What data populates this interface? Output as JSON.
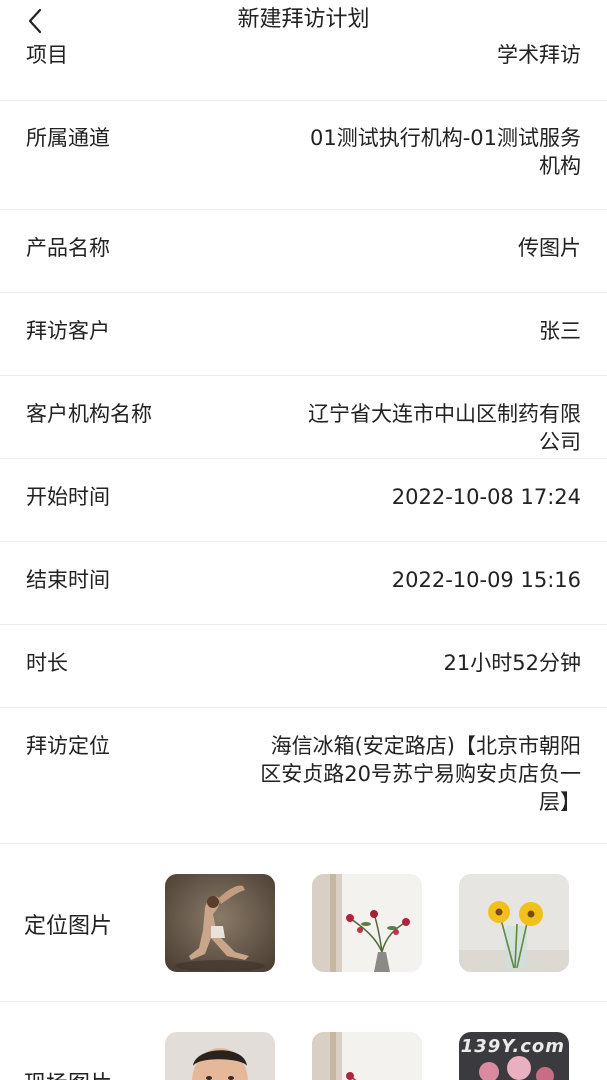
{
  "header": {
    "title": "新建拜访计划",
    "back_icon": "chevron-left-icon"
  },
  "partial_row": {
    "label": "项目",
    "value": "学术拜访"
  },
  "fields": [
    {
      "label": "所属通道",
      "value_lines": [
        "01测试执行机构-01测试服务",
        "机构"
      ]
    },
    {
      "label": "产品名称",
      "value_lines": [
        "传图片"
      ]
    },
    {
      "label": "拜访客户",
      "value_lines": [
        "张三"
      ]
    },
    {
      "label": "客户机构名称",
      "value_lines": [
        "辽宁省大连市中山区制药有限",
        "公司"
      ]
    },
    {
      "label": "开始时间",
      "value_lines": [
        "2022-10-08 17:24"
      ]
    },
    {
      "label": "结束时间",
      "value_lines": [
        "2022-10-09 15:16"
      ]
    },
    {
      "label": "时长",
      "value_lines": [
        "21小时52分钟"
      ]
    },
    {
      "label": "拜访定位",
      "value_lines": [
        "海信冰箱(安定路店)【北京市朝阳",
        "区安贞路20号苏宁易购安贞店负一",
        "层】"
      ]
    }
  ],
  "location_photos": {
    "label": "定位图片",
    "images": [
      "yoga-pose-photo",
      "vase-flowers-photo",
      "yellow-flowers-photo"
    ]
  },
  "site_photos": {
    "label": "现场图片",
    "images": [
      "man-portrait-photo",
      "vase-flowers-photo",
      "flowers-photo"
    ],
    "watermark": "139Y.com"
  }
}
